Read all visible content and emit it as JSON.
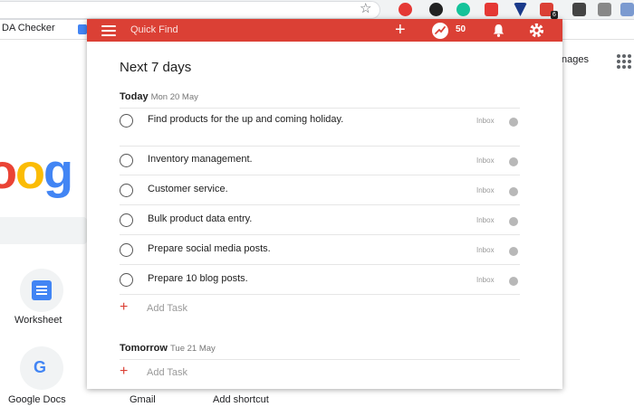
{
  "bookmarks": {
    "label": "DA Checker"
  },
  "google_page": {
    "images_link": "nages",
    "logo_fragment": "oog",
    "shortcuts": [
      {
        "label": "Worksheet"
      },
      {
        "label": "Google Docs"
      },
      {
        "label": "Gmail"
      },
      {
        "label": "Add shortcut"
      }
    ]
  },
  "extensions": {
    "badge": "6"
  },
  "todoist": {
    "accent": "#db4035",
    "topbar": {
      "quick_find": "Quick Find",
      "karma": "50"
    },
    "view_title": "Next 7 days",
    "sections": [
      {
        "day": "Today",
        "date": "Mon 20 May",
        "tasks": [
          {
            "text": "Find products for the up and coming holiday.",
            "project": "Inbox"
          },
          {
            "text": "Inventory management.",
            "project": "Inbox"
          },
          {
            "text": "Customer service.",
            "project": "Inbox"
          },
          {
            "text": "Bulk product data entry.",
            "project": "Inbox"
          },
          {
            "text": "Prepare social media posts.",
            "project": "Inbox"
          },
          {
            "text": "Prepare 10 blog posts.",
            "project": "Inbox"
          }
        ],
        "add_task": "Add Task"
      },
      {
        "day": "Tomorrow",
        "date": "Tue 21 May",
        "tasks": [],
        "add_task": "Add Task"
      }
    ]
  }
}
